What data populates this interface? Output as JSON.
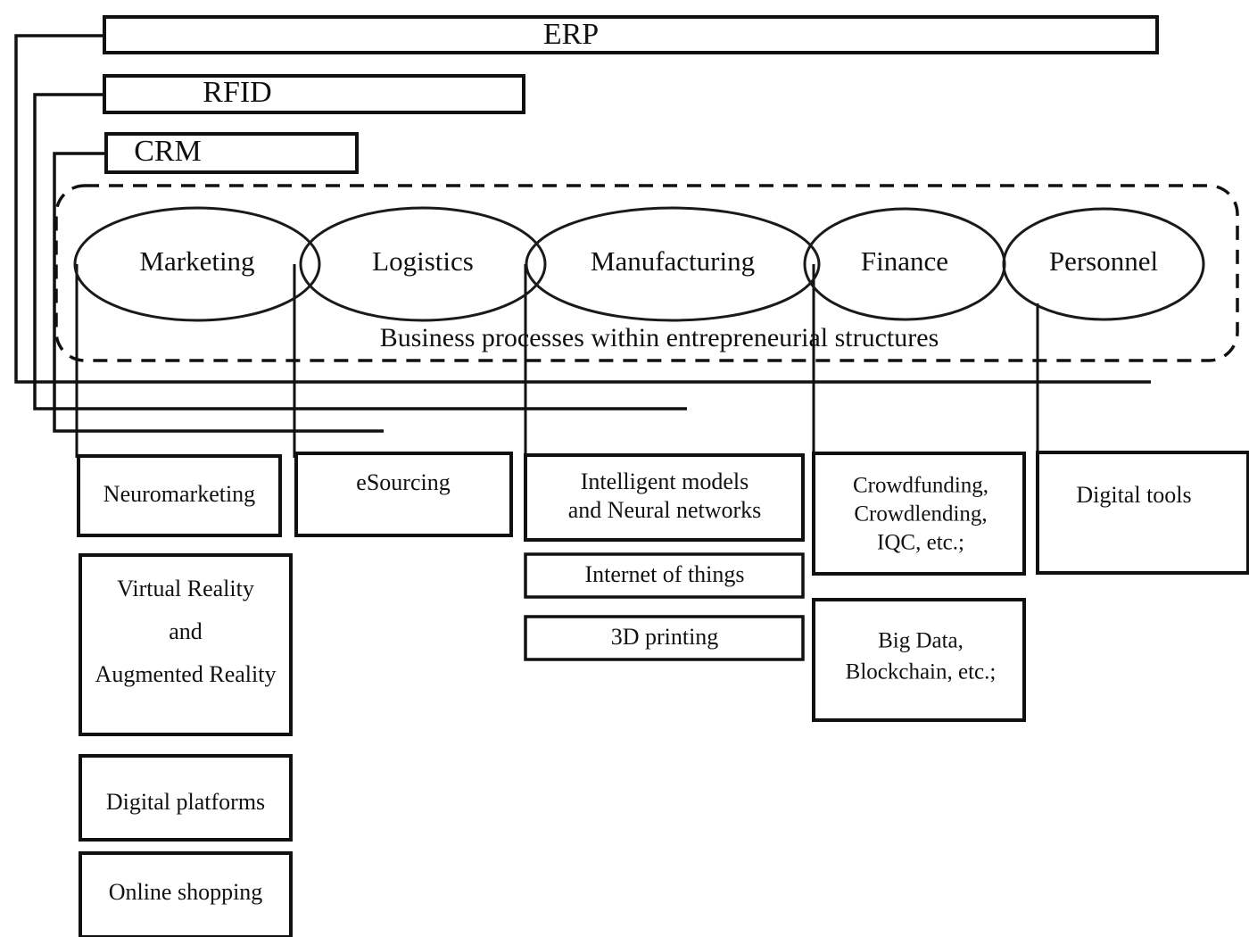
{
  "diagram": {
    "title_boxes": [
      {
        "id": "erp",
        "label": "ERP"
      },
      {
        "id": "rfid",
        "label": "RFID"
      },
      {
        "id": "crm",
        "label": "CRM"
      }
    ],
    "container": {
      "caption": "Business processes within entrepreneurial structures"
    },
    "processes": [
      {
        "id": "marketing",
        "label": "Marketing"
      },
      {
        "id": "logistics",
        "label": "Logistics"
      },
      {
        "id": "manufacturing",
        "label": "Manufacturing"
      },
      {
        "id": "finance",
        "label": "Finance"
      },
      {
        "id": "personnel",
        "label": "Personnel"
      }
    ],
    "columns": [
      {
        "id": "marketing-tools",
        "items": [
          {
            "id": "neuromarketing",
            "lines": [
              "Neuromarketing"
            ]
          },
          {
            "id": "vr-ar",
            "lines": [
              "Virtual Reality",
              "and",
              "Augmented Reality"
            ]
          },
          {
            "id": "digital-platforms",
            "lines": [
              "Digital platforms"
            ]
          },
          {
            "id": "online-shopping",
            "lines": [
              "Online shopping"
            ]
          }
        ]
      },
      {
        "id": "logistics-tools",
        "items": [
          {
            "id": "esourcing",
            "lines": [
              "eSourcing"
            ]
          }
        ]
      },
      {
        "id": "manufacturing-tools",
        "items": [
          {
            "id": "intelligent-models",
            "lines": [
              "Intelligent models",
              "and Neural networks"
            ]
          },
          {
            "id": "internet-of-things",
            "lines": [
              "Internet of things"
            ]
          },
          {
            "id": "3d-printing",
            "lines": [
              "3D printing"
            ]
          }
        ]
      },
      {
        "id": "finance-tools",
        "items": [
          {
            "id": "crowdfunding",
            "lines": [
              "Crowdfunding,",
              "Crowdlending,",
              "IQC, etc.;"
            ]
          },
          {
            "id": "big-data",
            "lines": [
              "Big Data,",
              "Blockchain, etc.;"
            ]
          }
        ]
      },
      {
        "id": "personnel-tools",
        "items": [
          {
            "id": "digital-tools",
            "lines": [
              "Digital tools"
            ]
          }
        ]
      }
    ],
    "colors": {
      "stroke": "#111111",
      "background": "#ffffff"
    }
  }
}
